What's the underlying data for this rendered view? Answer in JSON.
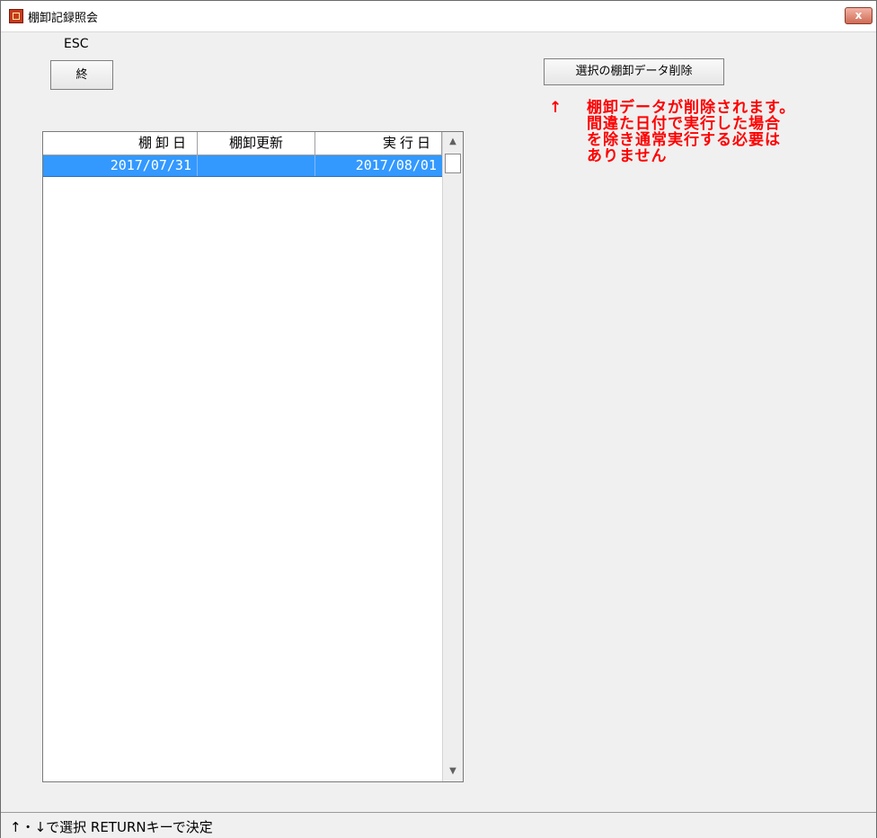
{
  "window": {
    "title": "棚卸記録照会",
    "close_label": "x"
  },
  "toolbar": {
    "esc_label": "ESC",
    "end_button_label": "終",
    "delete_button_label": "選択の棚卸データ削除"
  },
  "note": {
    "arrow": "↑",
    "lines": [
      "棚卸データが削除されます。",
      "間違た日付で実行した場合",
      "を除き通常実行する必要は",
      "ありません"
    ]
  },
  "grid": {
    "columns": [
      "棚卸日",
      "棚卸更新",
      "実行日"
    ],
    "rows": [
      {
        "date": "2017/07/31",
        "update": "",
        "exec_date": "2017/08/01",
        "selected": true
      }
    ],
    "scroll_up": "▲",
    "scroll_down": "▼"
  },
  "status": {
    "text": "↑・↓で選択  RETURNキーで決定"
  },
  "colors": {
    "selection": "#3399ff",
    "note": "#ff0000"
  }
}
